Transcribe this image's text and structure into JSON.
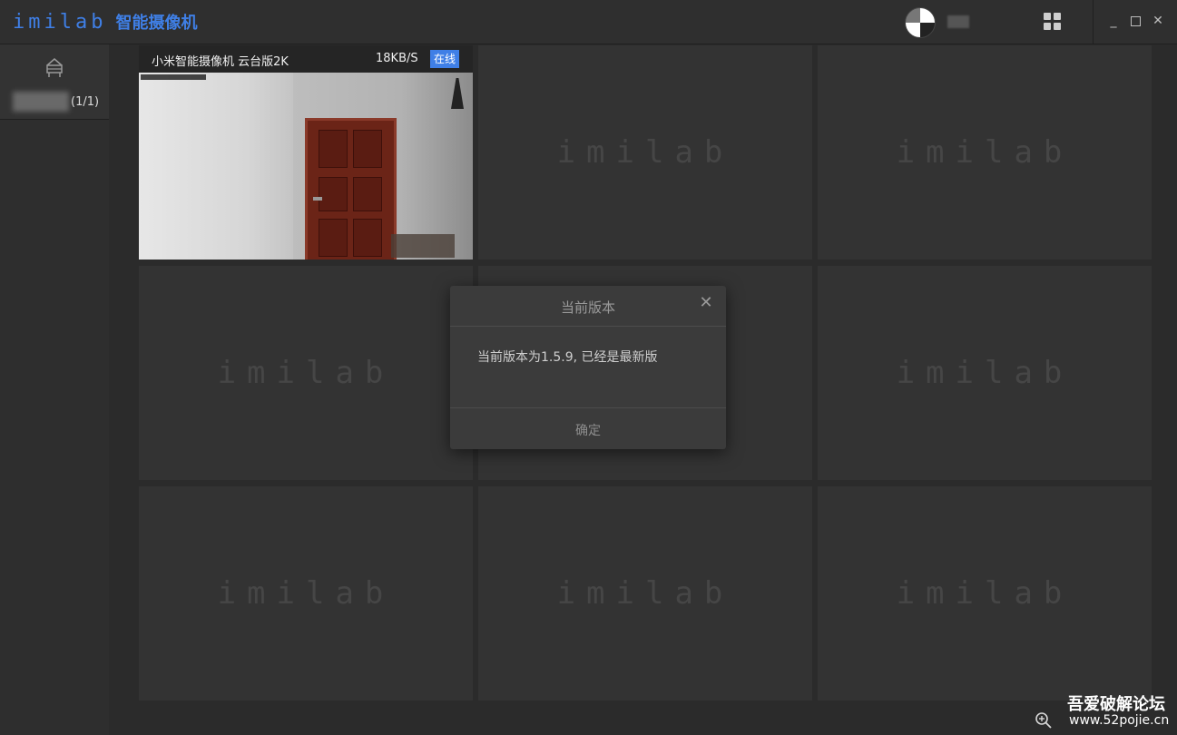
{
  "app": {
    "logo_text": "imilab",
    "title": "智能摄像机"
  },
  "sidebar": {
    "group_count": "(1/1)"
  },
  "cameras": [
    {
      "name": "小米智能摄像机 云台版2K",
      "speed": "18KB/S",
      "status": "在线"
    }
  ],
  "placeholder_logo": "imilab",
  "dialog": {
    "title": "当前版本",
    "message": "当前版本为1.5.9, 已经是最新版",
    "ok_label": "确定"
  },
  "watermark": {
    "cn": "吾爱破解论坛",
    "url": "www.52pojie.cn"
  },
  "colors": {
    "accent": "#3f7fe6",
    "background": "#2b2b2b",
    "tile": "#333333"
  },
  "icons": [
    "home-icon",
    "grid-layout-icon",
    "minimize-icon",
    "maximize-icon",
    "close-icon",
    "zoom-in-icon"
  ]
}
